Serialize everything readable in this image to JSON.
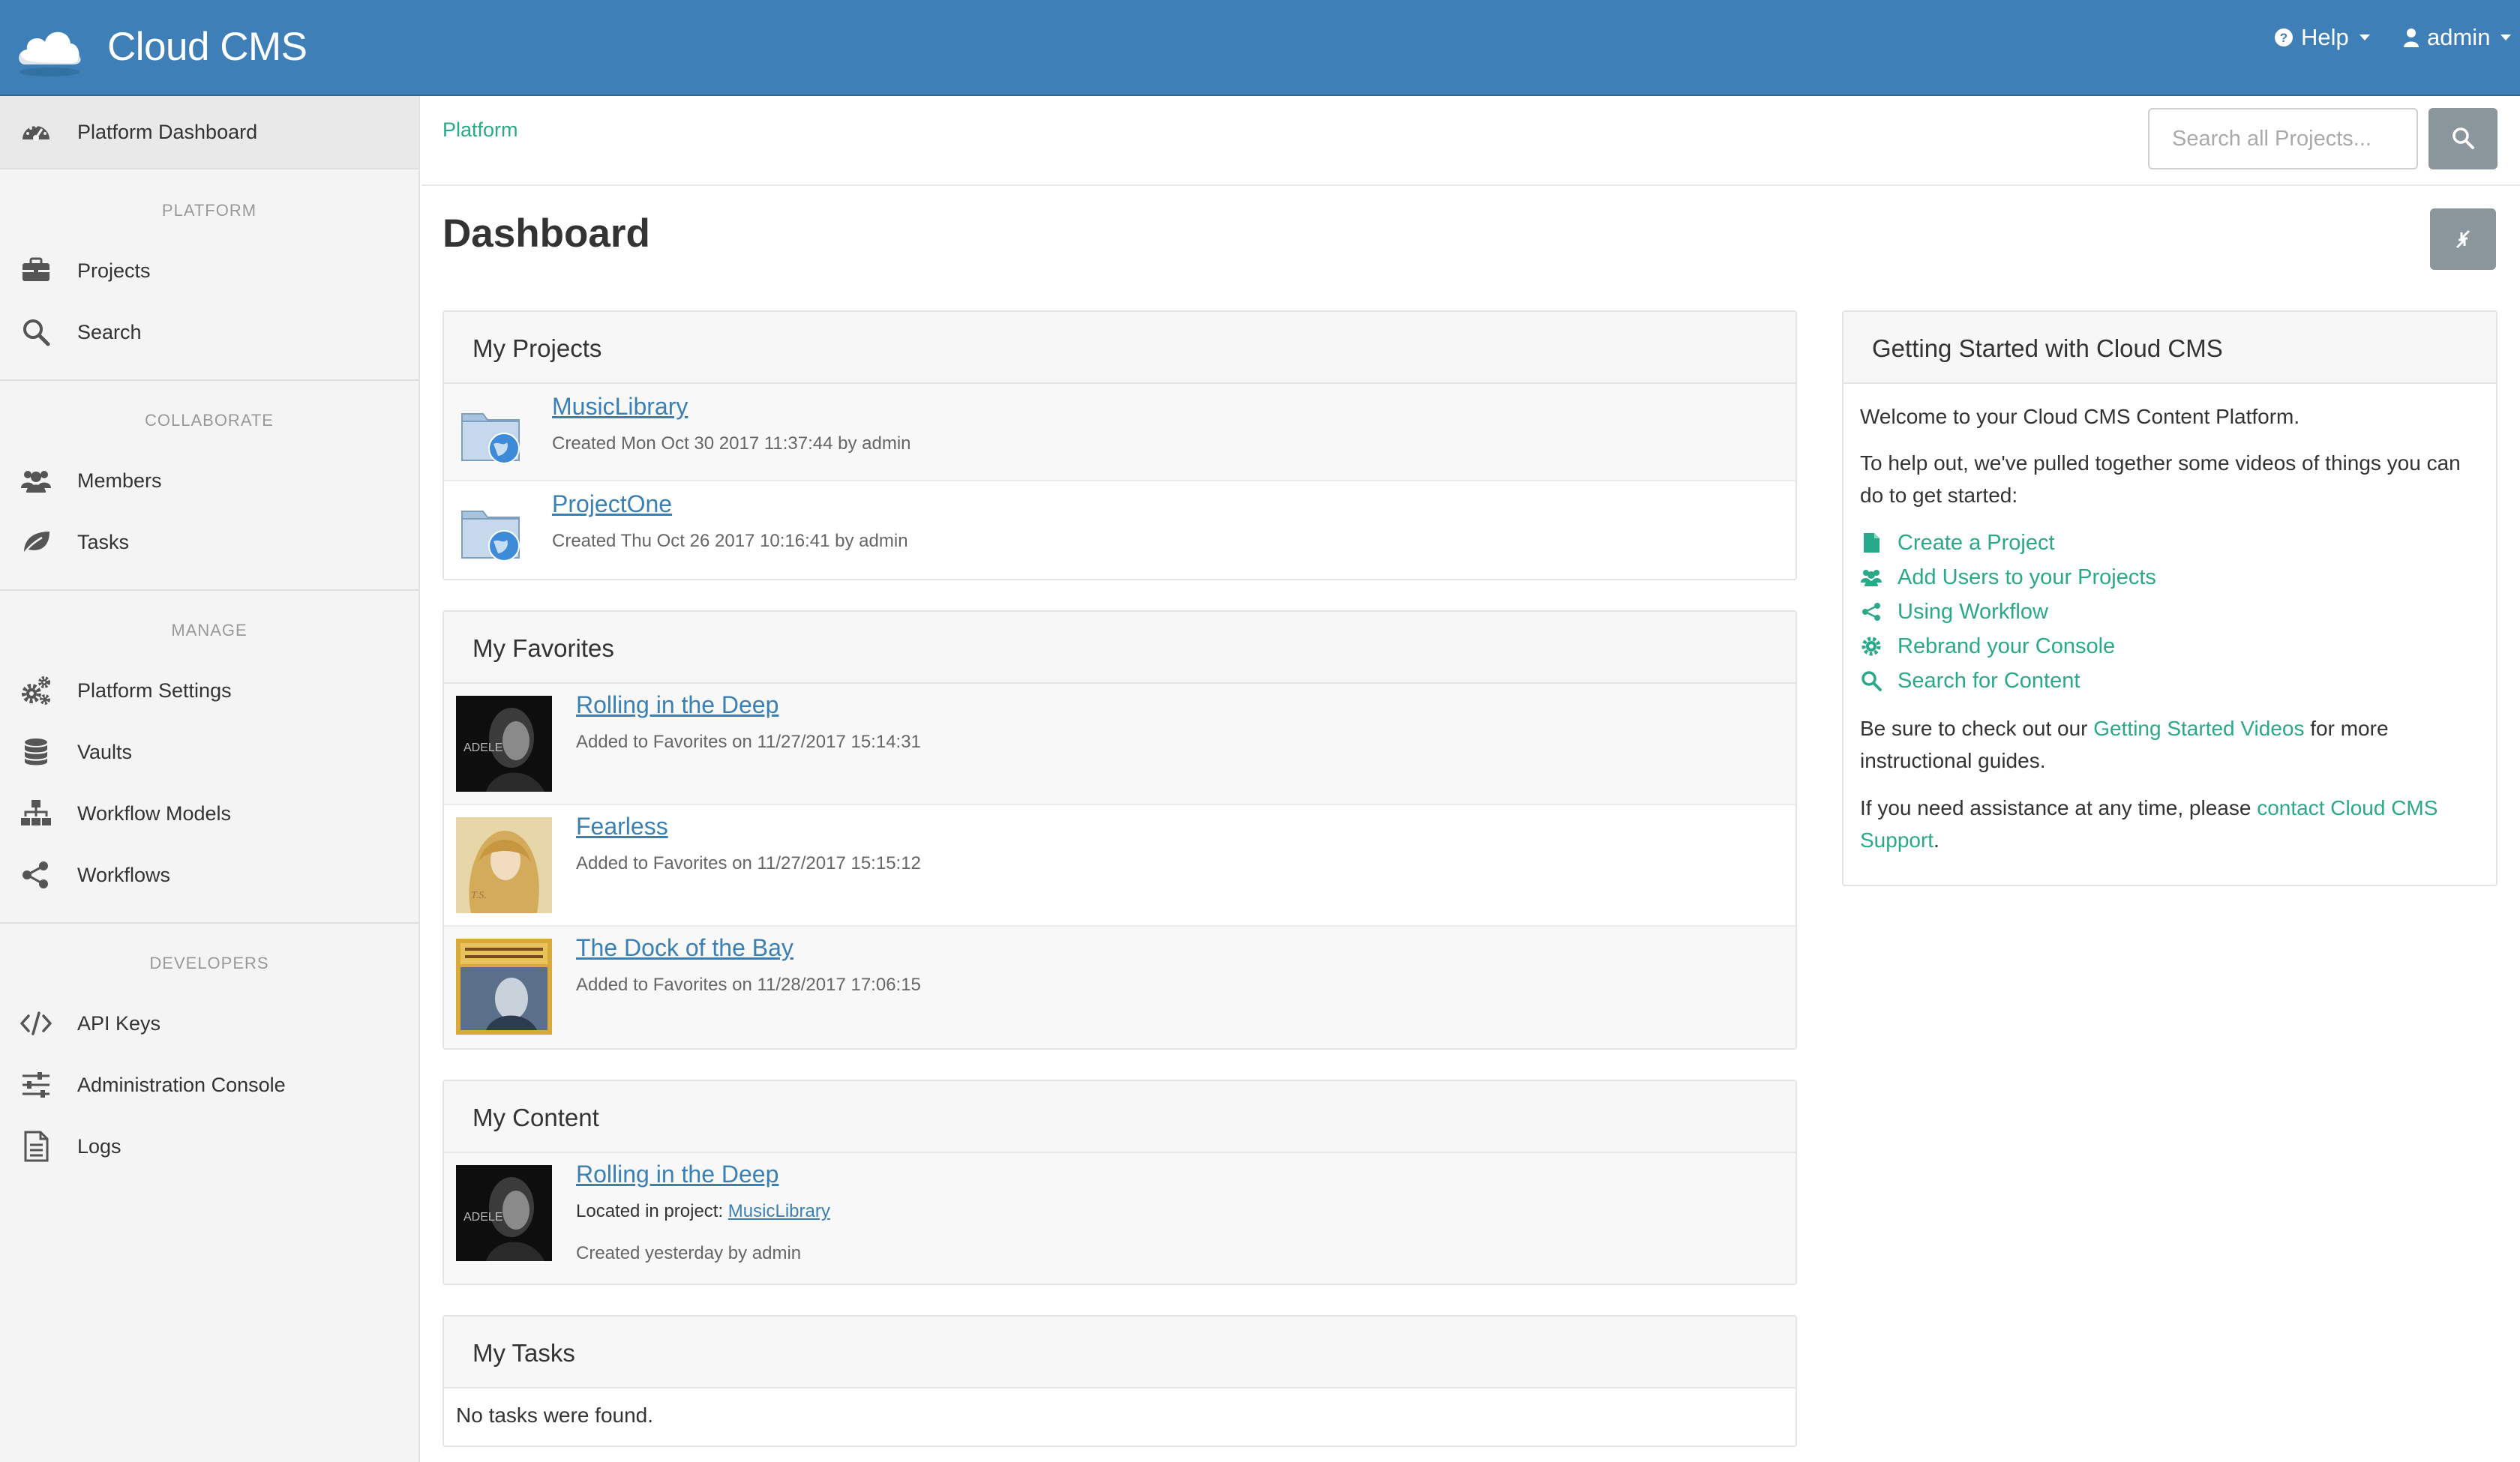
{
  "header": {
    "app_title": "Cloud CMS",
    "help_label": "Help",
    "admin_label": "admin"
  },
  "sidebar": {
    "dashboard_label": "Platform Dashboard",
    "sections": [
      {
        "header": "PLATFORM",
        "items": [
          {
            "label": "Projects",
            "icon": "briefcase-icon"
          },
          {
            "label": "Search",
            "icon": "search-icon"
          }
        ]
      },
      {
        "header": "COLLABORATE",
        "items": [
          {
            "label": "Members",
            "icon": "users-icon"
          },
          {
            "label": "Tasks",
            "icon": "leaf-icon"
          }
        ]
      },
      {
        "header": "MANAGE",
        "items": [
          {
            "label": "Platform Settings",
            "icon": "gears-icon"
          },
          {
            "label": "Vaults",
            "icon": "database-icon"
          },
          {
            "label": "Workflow Models",
            "icon": "sitemap-icon"
          },
          {
            "label": "Workflows",
            "icon": "share-icon"
          }
        ]
      },
      {
        "header": "DEVELOPERS",
        "items": [
          {
            "label": "API Keys",
            "icon": "code-icon"
          },
          {
            "label": "Administration Console",
            "icon": "sliders-icon"
          },
          {
            "label": "Logs",
            "icon": "file-text-icon"
          }
        ]
      }
    ]
  },
  "breadcrumb": {
    "label": "Platform"
  },
  "search": {
    "placeholder": "Search all Projects..."
  },
  "page": {
    "title": "Dashboard"
  },
  "my_projects": {
    "title": "My Projects",
    "items": [
      {
        "name": "MusicLibrary",
        "meta": "Created Mon Oct 30 2017 11:37:44 by admin"
      },
      {
        "name": "ProjectOne",
        "meta": "Created Thu Oct 26 2017 10:16:41 by admin"
      }
    ]
  },
  "my_favorites": {
    "title": "My Favorites",
    "items": [
      {
        "name": "Rolling in the Deep",
        "meta": "Added to Favorites on 11/27/2017 15:14:31"
      },
      {
        "name": "Fearless",
        "meta": "Added to Favorites on 11/27/2017 15:15:12"
      },
      {
        "name": "The Dock of the Bay",
        "meta": "Added to Favorites on 11/28/2017 17:06:15"
      }
    ]
  },
  "my_content": {
    "title": "My Content",
    "item": {
      "name": "Rolling in the Deep",
      "location_prefix": "Located in project:",
      "project": "MusicLibrary",
      "created": "Created yesterday by admin"
    }
  },
  "my_tasks": {
    "title": "My Tasks",
    "empty": "No tasks were found."
  },
  "getting_started": {
    "title": "Getting Started with Cloud CMS",
    "welcome": "Welcome to your Cloud CMS Content Platform.",
    "intro": "To help out, we've pulled together some videos of things you can do to get started:",
    "links": [
      {
        "label": "Create a Project",
        "icon": "file-icon"
      },
      {
        "label": "Add Users to your Projects",
        "icon": "users-icon"
      },
      {
        "label": "Using Workflow",
        "icon": "share-icon"
      },
      {
        "label": "Rebrand your Console",
        "icon": "gear-icon"
      },
      {
        "label": "Search for Content",
        "icon": "search-icon"
      }
    ],
    "videos_prefix": "Be sure to check out our ",
    "videos_link": "Getting Started Videos",
    "videos_suffix": " for more instructional guides.",
    "support_prefix": "If you need assistance at any time, please ",
    "support_link": "contact Cloud CMS Support",
    "support_suffix": "."
  },
  "colors": {
    "header_bg": "#3f7fb7",
    "link_blue": "#3b80b5",
    "link_green": "#2aa88a",
    "sidebar_bg": "#f4f4f4"
  }
}
